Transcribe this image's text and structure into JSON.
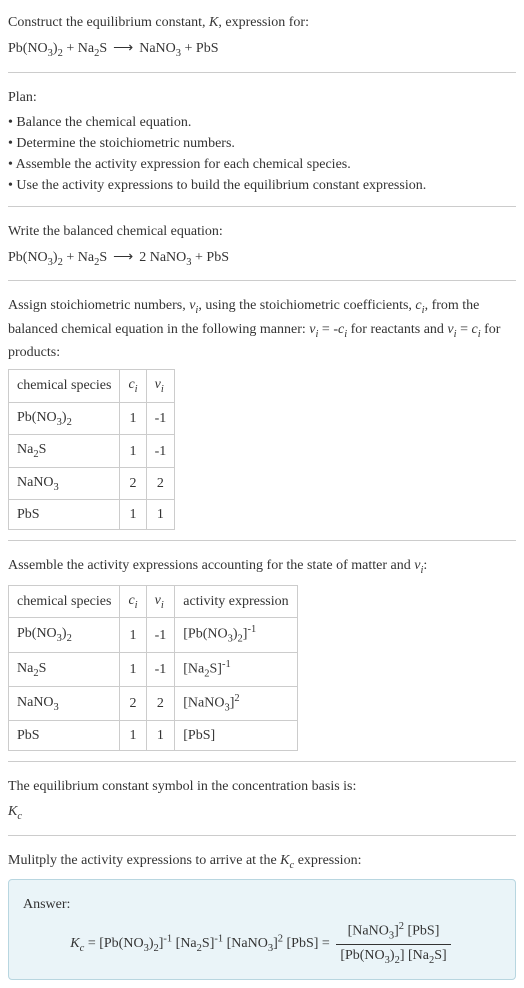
{
  "intro": {
    "line1": "Construct the equilibrium constant, ",
    "K": "K",
    "line1b": ", expression for:",
    "eq_lhs1": "Pb(NO",
    "eq_lhs1_sub": "3",
    "eq_lhs1_close": ")",
    "eq_lhs1_sub2": "2",
    "plus": " + ",
    "na2s": "Na",
    "na2s_sub": "2",
    "na2s_s": "S",
    "arrow": "⟶",
    "nano3": "NaNO",
    "nano3_sub": "3",
    "pbs": "PbS"
  },
  "plan": {
    "header": "Plan:",
    "items": [
      "Balance the chemical equation.",
      "Determine the stoichiometric numbers.",
      "Assemble the activity expression for each chemical species.",
      "Use the activity expressions to build the equilibrium constant expression."
    ]
  },
  "balanced": {
    "header": "Write the balanced chemical equation:",
    "coef2": "2"
  },
  "stoich": {
    "header_a": "Assign stoichiometric numbers, ",
    "nu": "ν",
    "i": "i",
    "header_b": ", using the stoichiometric coefficients, ",
    "c": "c",
    "header_c": ", from the balanced chemical equation in the following manner: ",
    "eq1": " = -",
    "header_d": " for reactants and ",
    "eq2": " = ",
    "header_e": " for products:",
    "table": {
      "h1": "chemical species",
      "h2": "c",
      "h3": "ν",
      "rows": [
        {
          "sp": "Pb(NO₃)₂",
          "c": "1",
          "v": "-1"
        },
        {
          "sp": "Na₂S",
          "c": "1",
          "v": "-1"
        },
        {
          "sp": "NaNO₃",
          "c": "2",
          "v": "2"
        },
        {
          "sp": "PbS",
          "c": "1",
          "v": "1"
        }
      ]
    }
  },
  "activity": {
    "header_a": "Assemble the activity expressions accounting for the state of matter and ",
    "header_b": ":",
    "h4": "activity expression",
    "rows": [
      {
        "c": "1",
        "v": "-1"
      },
      {
        "c": "1",
        "v": "-1"
      },
      {
        "c": "2",
        "v": "2"
      },
      {
        "c": "1",
        "v": "1"
      }
    ]
  },
  "symbol": {
    "line1": "The equilibrium constant symbol in the concentration basis is:",
    "kc": "K",
    "c": "c"
  },
  "multiply": {
    "line1a": "Mulitply the activity expressions to arrive at the ",
    "line1b": " expression:"
  },
  "answer": {
    "label": "Answer:",
    "eq": " = "
  }
}
